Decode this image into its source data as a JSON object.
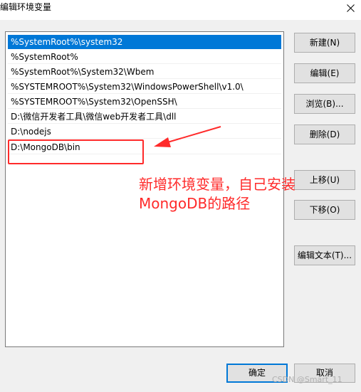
{
  "window": {
    "title": "编辑环境变量",
    "close_glyph": "✕"
  },
  "path_list": {
    "items": [
      {
        "value": "%SystemRoot%\\system32",
        "selected": true
      },
      {
        "value": "%SystemRoot%",
        "selected": false
      },
      {
        "value": "%SystemRoot%\\System32\\Wbem",
        "selected": false
      },
      {
        "value": "%SYSTEMROOT%\\System32\\WindowsPowerShell\\v1.0\\",
        "selected": false
      },
      {
        "value": "%SYSTEMROOT%\\System32\\OpenSSH\\",
        "selected": false
      },
      {
        "value": "D:\\微信开发者工具\\微信web开发者工具\\dll",
        "selected": false
      },
      {
        "value": "D:\\nodejs",
        "selected": false
      },
      {
        "value": "D:\\MongoDB\\bin",
        "selected": false
      }
    ]
  },
  "buttons": {
    "new": "新建(N)",
    "edit": "编辑(E)",
    "browse": "浏览(B)...",
    "delete": "删除(D)",
    "move_up": "上移(U)",
    "move_down": "下移(O)",
    "edit_text": "编辑文本(T)...",
    "ok": "确定",
    "cancel": "取消"
  },
  "annotation": {
    "line1": "新增环境变量，自己安装",
    "line2": "MongoDB的路径"
  },
  "watermark": "CSDN @Smart_11",
  "colors": {
    "selection": "#0078d7",
    "annotation": "#ff2a2a"
  }
}
